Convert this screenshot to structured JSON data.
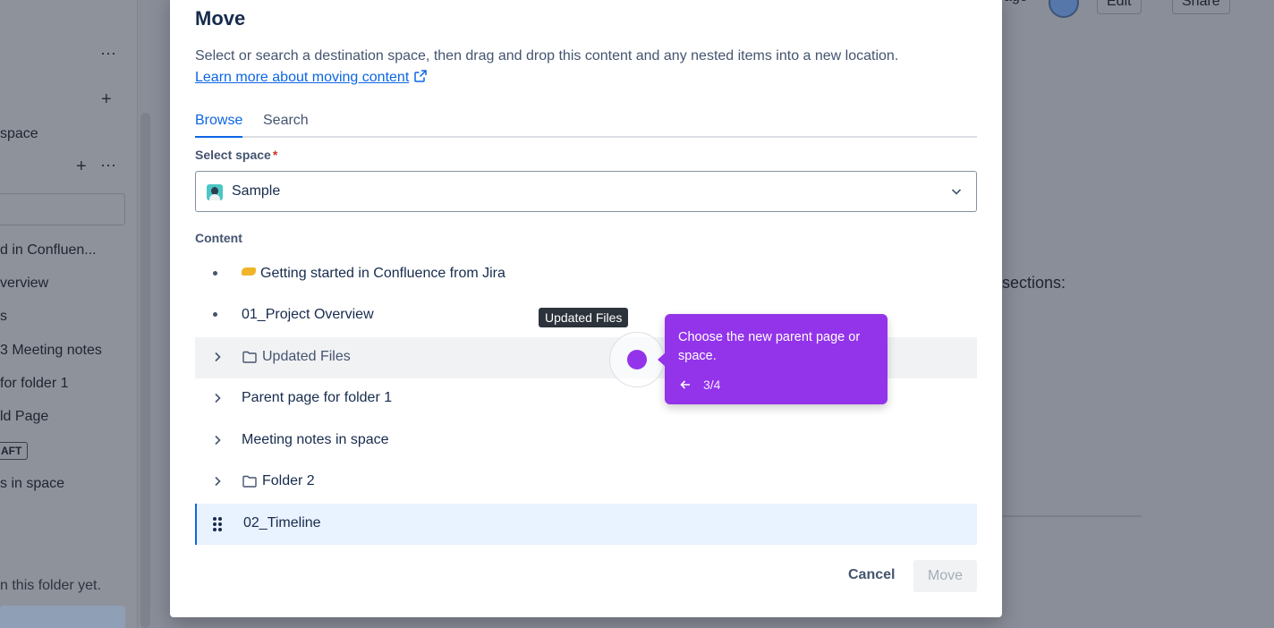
{
  "background": {
    "sidebar_items": [
      "space",
      "d in Confluen...",
      "verview",
      "s",
      "3 Meeting notes",
      "for folder 1",
      "ld Page",
      "s in space"
    ],
    "draft_badge": "AFT",
    "empty_folder_text": "n this folder yet.",
    "main_text": "sections:",
    "header_time": "ago",
    "edit_label": "Edit",
    "share_label": "Share"
  },
  "modal": {
    "title": "Move",
    "description": "Select or search a destination space, then drag and drop this content and any nested items into a new location.",
    "learn_more": "Learn more about moving content",
    "tabs": [
      "Browse",
      "Search"
    ],
    "select_space_label": "Select space",
    "required_mark": "*",
    "selected_space": "Sample",
    "content_label": "Content",
    "tree": [
      {
        "label": "Getting started in Confluence from Jira",
        "type": "page-emoji"
      },
      {
        "label": "01_Project Overview",
        "type": "page"
      },
      {
        "label": "Updated Files",
        "type": "folder"
      },
      {
        "label": "Parent page for folder 1",
        "type": "expandable"
      },
      {
        "label": "Meeting notes in space",
        "type": "expandable"
      },
      {
        "label": "Folder 2",
        "type": "folder"
      },
      {
        "label": "02_Timeline",
        "type": "dragging"
      }
    ],
    "cancel_label": "Cancel",
    "move_label": "Move"
  },
  "guide": {
    "hover_tooltip": "Updated Files",
    "text": "Choose the new parent page or space.",
    "step": "3/4",
    "accent_color": "#9333ea"
  }
}
